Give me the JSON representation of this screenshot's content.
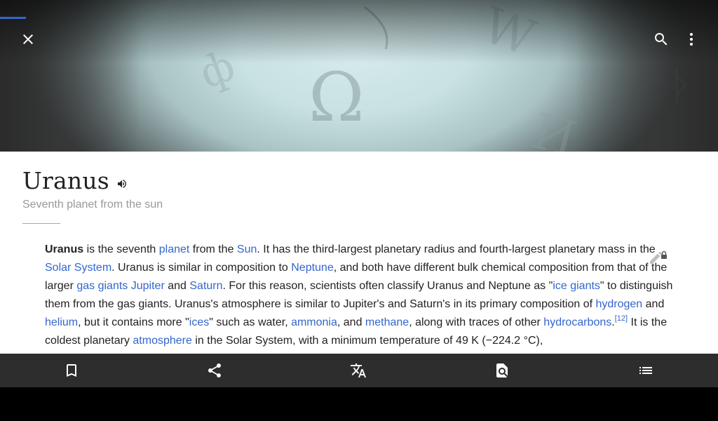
{
  "toolbar": {
    "close_icon": "close-icon",
    "search_icon": "search-icon",
    "overflow_icon": "more-vert-icon",
    "load_progress": 0.036
  },
  "article": {
    "title": "Uranus",
    "description": "Seventh planet from the sun",
    "audio_icon": "speaker-icon",
    "edit_icon": "edit-locked-icon",
    "lead": {
      "seg01": "Uranus",
      "seg02": " is the seventh ",
      "link_planet": "planet",
      "seg03": " from the ",
      "link_sun": "Sun",
      "seg04": ". It has the third-largest planetary radius and fourth-largest planetary mass in the ",
      "link_solar_system": "Solar System",
      "seg05": ". Uranus is similar in composition to ",
      "link_neptune": "Neptune",
      "seg06": ", and both have different bulk chemical composition from that of the larger ",
      "link_gas_giants": "gas giants",
      "seg07": " ",
      "link_jupiter": "Jupiter",
      "seg08": " and ",
      "link_saturn": "Saturn",
      "seg09": ". For this reason, scientists often classify Uranus and Neptune as \"",
      "link_ice_giants": "ice giants",
      "seg10": "\" to distinguish them from the gas giants. Uranus's atmosphere is similar to Jupiter's and Saturn's in its primary composition of ",
      "link_hydrogen": "hydrogen",
      "seg11": " and ",
      "link_helium": "helium",
      "seg12": ", but it contains more \"",
      "link_ices": "ices",
      "seg13": "\" such as water, ",
      "link_ammonia": "ammonia",
      "seg14": ", and ",
      "link_methane": "methane",
      "seg15": ", along with traces of other ",
      "link_hydrocarbons": "hydrocarbons",
      "seg16": ".",
      "ref12": "[12]",
      "seg17": " It is the coldest planetary ",
      "link_atmosphere": "atmosphere",
      "seg18": " in the Solar System, with a minimum temperature of 49 K (−224.2 °C),"
    }
  },
  "action_bar": {
    "items": [
      {
        "icon": "bookmark-icon"
      },
      {
        "icon": "share-icon"
      },
      {
        "icon": "translate-icon"
      },
      {
        "icon": "find-in-page-icon"
      },
      {
        "icon": "contents-list-icon"
      }
    ]
  },
  "colors": {
    "link": "#3366cc",
    "progress": "#3366cc",
    "action_bar": "#2d2d2d",
    "text": "#222222",
    "description": "#999999"
  }
}
